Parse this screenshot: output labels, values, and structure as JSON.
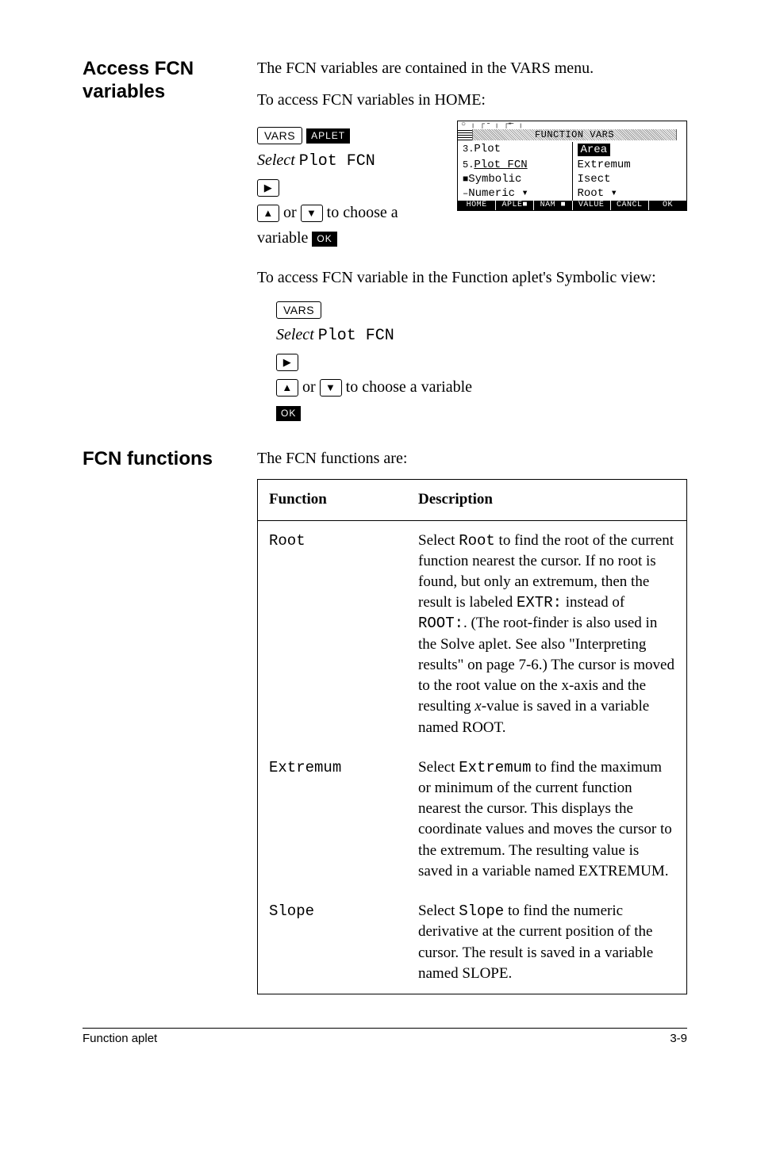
{
  "section1": {
    "heading": "Access FCN variables",
    "intro1": "The FCN variables are contained in the VARS menu.",
    "intro2": "To access FCN variables in HOME:",
    "steps1": {
      "vars_key": "VARS",
      "aplet_soft": "APLET",
      "select_prefix": "Select",
      "select_value": "Plot  FCN",
      "right_arrow": "▶",
      "up_arrow": "▲",
      "or_text": " or ",
      "down_arrow": "▼",
      "choose_text": " to choose a",
      "variable_text": "variable ",
      "ok_soft": "OK"
    },
    "screen": {
      "top_ticks": "○   ╷   ┌╶   ╷   ┌╾   ╷",
      "title": "FUNCTION  VARS",
      "rows": [
        {
          "l": "Plot",
          "r": "Area",
          "lsel": false,
          "rsel": true,
          "lprefix": "3."
        },
        {
          "l": "Plot FCN",
          "r": "Extremum",
          "lsel": true,
          "rsel": false,
          "lprefix": "5."
        },
        {
          "l": "Symbolic",
          "r": "Isect",
          "lsel": false,
          "rsel": false,
          "lprefix": "■"
        },
        {
          "l": "Numeric ▾",
          "r": "Root         ▾",
          "lsel": false,
          "rsel": false,
          "lprefix": "–"
        }
      ],
      "foot": [
        "HOME",
        "APLE■",
        "NAM ■",
        "VALUE",
        "CANCL",
        "OK"
      ]
    },
    "intro3": "To access FCN variable in the Function aplet's Symbolic view:",
    "steps2": {
      "vars_key": "VARS",
      "select_prefix": "Select",
      "select_value": "Plot  FCN",
      "right_arrow": "▶",
      "up_arrow": "▲",
      "or_text": " or ",
      "down_arrow": "▼",
      "choose_text": " to choose a variable",
      "ok_soft": "OK"
    }
  },
  "section2": {
    "heading": "FCN functions",
    "intro": "The FCN functions are:",
    "table": {
      "headers": {
        "fn": "Function",
        "desc": "Description"
      },
      "rows": [
        {
          "fn": "Root",
          "desc_pre": "Select ",
          "desc_mono": "Root",
          "desc_mid": " to find the root of the current function nearest the cursor. If no root is found, but only an extremum, then the result is labeled ",
          "desc_mono2": "EXTR:",
          "desc_mid2": " instead of ",
          "desc_mono3": "ROOT:",
          "desc_post": ". (The root-finder is also used in the Solve aplet. See also \"Interpreting results\" on page 7-6.) The cursor is moved to the root value on the x-axis and the resulting ",
          "desc_ital": "x",
          "desc_tail": "-value is saved in a variable named ROOT."
        },
        {
          "fn": "Extremum",
          "desc_pre": "Select ",
          "desc_mono": "Extremum",
          "desc_post": " to find the maximum or minimum of the current function nearest the cursor. This displays the coordinate values and moves the cursor to the extremum. The resulting value is saved in a variable named EXTREMUM."
        },
        {
          "fn": "Slope",
          "desc_pre": "Select ",
          "desc_mono": "Slope",
          "desc_post": " to find the numeric derivative at the current position of the cursor. The result is saved in a variable named SLOPE."
        }
      ]
    }
  },
  "footer": {
    "left": "Function aplet",
    "right": "3-9"
  }
}
